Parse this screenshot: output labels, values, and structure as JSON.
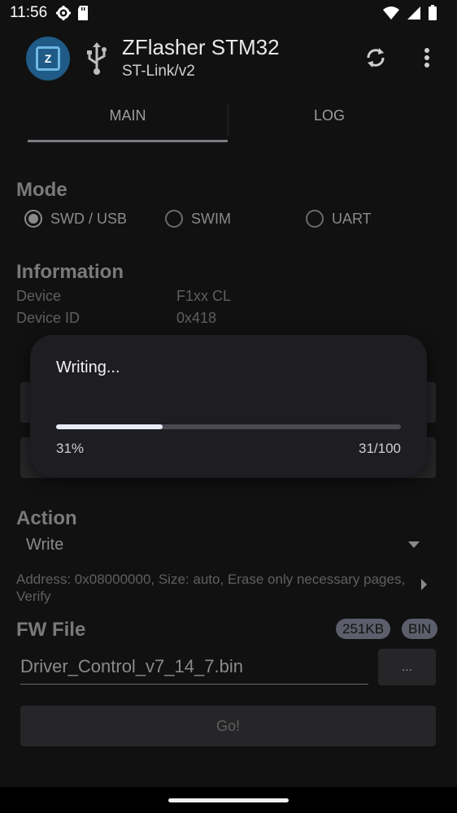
{
  "status_bar": {
    "time": "11:56"
  },
  "app_bar": {
    "title": "ZFlasher STM32",
    "subtitle": "ST-Link/v2"
  },
  "tabs": [
    {
      "label": "MAIN",
      "selected": true
    },
    {
      "label": "LOG",
      "selected": false
    }
  ],
  "mode": {
    "title": "Mode",
    "options": [
      {
        "label": "SWD / USB",
        "selected": true
      },
      {
        "label": "SWIM",
        "selected": false
      },
      {
        "label": "UART",
        "selected": false
      }
    ]
  },
  "information": {
    "title": "Information",
    "rows": [
      {
        "label": "Device",
        "value": "F1xx CL"
      },
      {
        "label": "Device ID",
        "value": "0x418"
      }
    ]
  },
  "action": {
    "title": "Action",
    "selected": "Write",
    "description": "Address: 0x08000000, Size: auto, Erase only necessary pages, Verify"
  },
  "fw_file": {
    "title": "FW File",
    "size_badge": "251KB",
    "type_badge": "BIN",
    "filename": "Driver_Control_v7_14_7.bin",
    "browse_label": "...",
    "go_label": "Go!"
  },
  "dialog": {
    "title": "Writing...",
    "progress_percent_label": "31%",
    "progress_count_label": "31/100",
    "progress_fraction": 0.31
  },
  "colors": {
    "accent": "#e8e9f6",
    "badge": "#5d5e6b",
    "logo": "#1f5b86"
  }
}
